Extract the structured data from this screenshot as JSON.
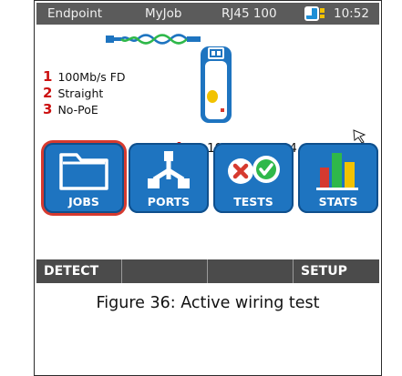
{
  "statusbar": {
    "mode": "Endpoint",
    "profile": "MyJob",
    "port": "RJ45 100",
    "time": "10:52",
    "battery_icon": "battery-icon"
  },
  "results": [
    {
      "num": "1",
      "text": "100Mb/s FD"
    },
    {
      "num": "2",
      "text": "Straight"
    },
    {
      "num": "3",
      "text": "No-PoE"
    }
  ],
  "ip": {
    "num": "4",
    "text": "IP:192.10.100.34"
  },
  "tiles": [
    {
      "label": "JOBS",
      "icon": "folder-icon",
      "selected": true
    },
    {
      "label": "PORTS",
      "icon": "network-ports-icon",
      "selected": false
    },
    {
      "label": "TESTS",
      "icon": "pass-fail-icon",
      "selected": false
    },
    {
      "label": "STATS",
      "icon": "bar-chart-icon",
      "selected": false
    }
  ],
  "softkeys": [
    "DETECT",
    "",
    "",
    "SETUP"
  ],
  "caption": "Figure 36: Active wiring test",
  "colors": {
    "statusbar": "#5b5b5b",
    "tile": "#1e74c0",
    "selected_outline": "#d63a2f",
    "softkey_bar": "#4b4b4b",
    "number_red": "#cc1111"
  }
}
